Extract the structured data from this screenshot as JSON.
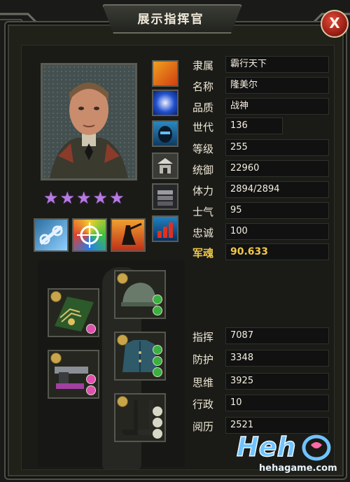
{
  "window": {
    "title": "展示指挥官",
    "close_label": "X"
  },
  "stars": {
    "count": 5,
    "glyph": "★"
  },
  "info_rows": [
    {
      "label": "隶属",
      "value": "霸行天下"
    },
    {
      "label": "名称",
      "value": "隆美尔"
    },
    {
      "label": "品质",
      "value": "战神"
    },
    {
      "label": "世代",
      "value": "136"
    },
    {
      "label": "等级",
      "value": "255"
    },
    {
      "label": "统御",
      "value": "22960"
    },
    {
      "label": "体力",
      "value": "2894/2894"
    },
    {
      "label": "士气",
      "value": "95"
    },
    {
      "label": "忠诚",
      "value": "100"
    },
    {
      "label": "军魂",
      "value": "90.633"
    }
  ],
  "stat_rows": [
    {
      "label": "指挥",
      "value": "7087"
    },
    {
      "label": "防护",
      "value": "3348"
    },
    {
      "label": "思维",
      "value": "3925"
    },
    {
      "label": "行政",
      "value": "10"
    },
    {
      "label": "阅历",
      "value": "2521"
    }
  ],
  "watermark": {
    "brand": "Heh",
    "site": "hehagame.com"
  },
  "colors": {
    "soul": "#f0c84a",
    "star": "#b67ae0",
    "close": "#c8281c"
  }
}
